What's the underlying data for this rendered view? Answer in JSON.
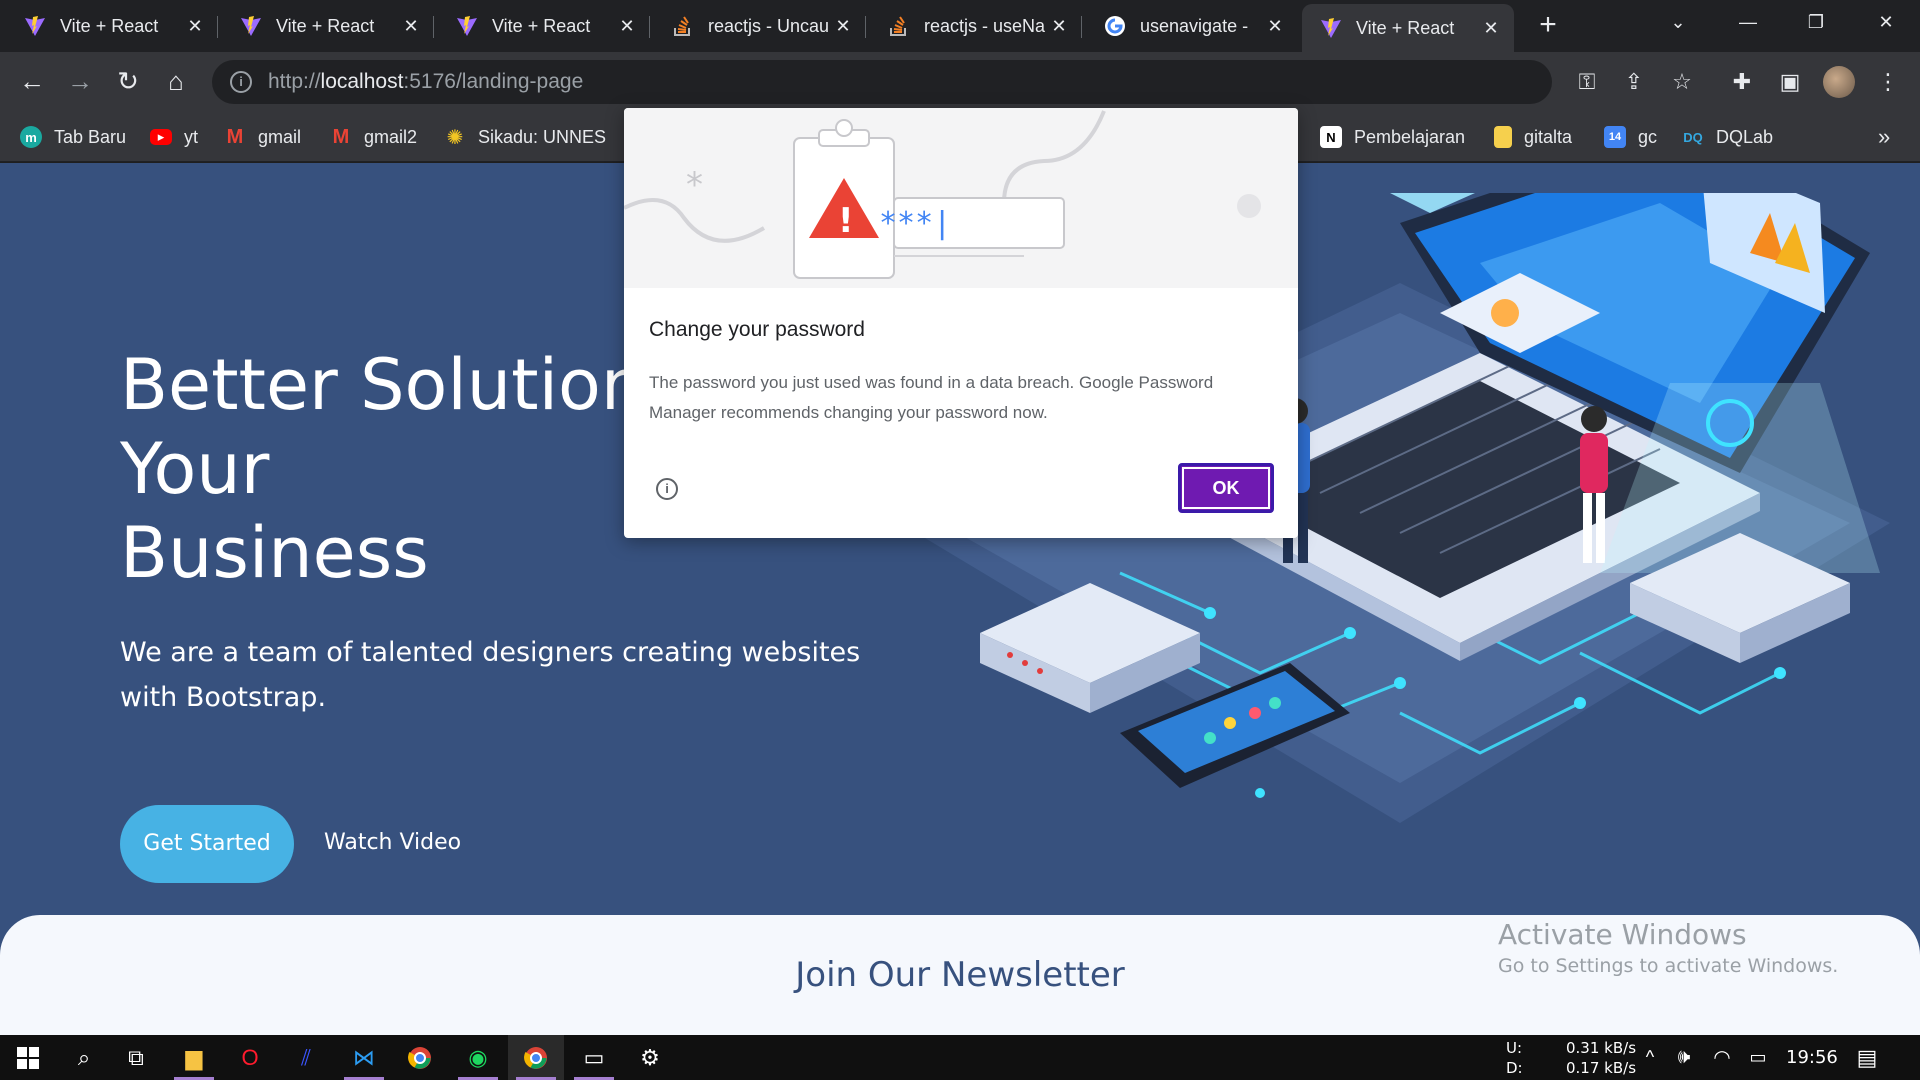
{
  "browser": {
    "tabs": [
      {
        "title": "Vite + React",
        "icon": "vite-icon",
        "active": false
      },
      {
        "title": "Vite + React",
        "icon": "vite-icon",
        "active": false
      },
      {
        "title": "Vite + React",
        "icon": "vite-icon",
        "active": false
      },
      {
        "title": "reactjs - Uncau",
        "icon": "stackoverflow-icon",
        "active": false
      },
      {
        "title": "reactjs - useNa",
        "icon": "stackoverflow-icon",
        "active": false
      },
      {
        "title": "usenavigate -",
        "icon": "google-icon",
        "active": false
      },
      {
        "title": "Vite + React",
        "icon": "vite-icon",
        "active": true
      }
    ],
    "new_tab_glyph": "+",
    "address": {
      "scheme": "http://",
      "host": "localhost",
      "rest": ":5176/landing-page"
    },
    "bookmarks": [
      {
        "label": "Tab Baru",
        "icon": "mtab-icon"
      },
      {
        "label": "yt",
        "icon": "youtube-icon"
      },
      {
        "label": "gmail",
        "icon": "gmail-icon"
      },
      {
        "label": "gmail2",
        "icon": "gmail-icon"
      },
      {
        "label": "Sikadu: UNNES",
        "icon": "unnes-icon"
      },
      {
        "label": "Pembelajaran",
        "icon": "notion-icon"
      },
      {
        "label": "gitalta",
        "icon": "folder-icon"
      },
      {
        "label": "gc",
        "icon": "calendar-icon"
      },
      {
        "label": "DQLab",
        "icon": "dqlab-icon"
      }
    ],
    "bookmarks_overflow": "»"
  },
  "page": {
    "hero_title_lines": [
      "Better Solutions For",
      "Your",
      "Business"
    ],
    "hero_subtitle": "We are a team of talented designers creating websites with Bootstrap.",
    "get_started": "Get Started",
    "watch_video": "Watch Video",
    "newsletter_title": "Join Our Newsletter"
  },
  "dialog": {
    "title": "Change your password",
    "body": "The password you just used was found in a data breach. Google Password Manager recommends changing your password now.",
    "ok_label": "OK",
    "illustration_password_mask": "***|"
  },
  "watermark": {
    "line1": "Activate Windows",
    "line2": "Go to Settings to activate Windows."
  },
  "taskbar": {
    "net_up_label": "U:",
    "net_down_label": "D:",
    "net_up": "0.31 kB/s",
    "net_down": "0.17 kB/s",
    "time": "19:56"
  },
  "colors": {
    "hero_bg": "#37517e",
    "accent": "#47b2e4",
    "dialog_ok": "#6f1ab1"
  }
}
